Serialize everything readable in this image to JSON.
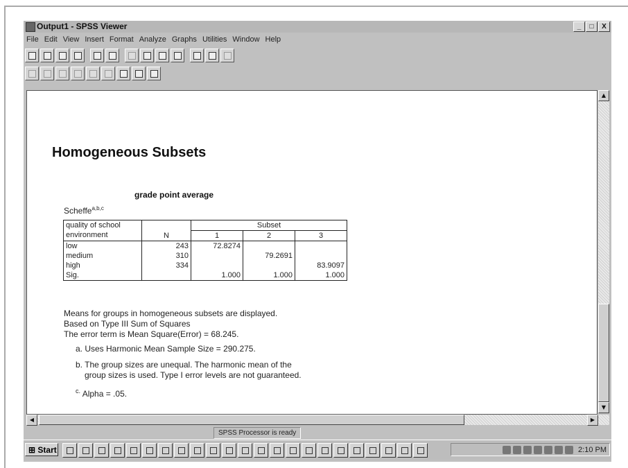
{
  "window": {
    "title": "Output1 - SPSS Viewer",
    "controls": [
      "_",
      "□",
      "X"
    ]
  },
  "menubar": {
    "items": [
      {
        "label": "File"
      },
      {
        "label": "Edit"
      },
      {
        "label": "View"
      },
      {
        "label": "Insert"
      },
      {
        "label": "Format"
      },
      {
        "label": "Analyze"
      },
      {
        "label": "Graphs"
      },
      {
        "label": "Utilities"
      },
      {
        "label": "Window"
      },
      {
        "label": "Help"
      }
    ]
  },
  "document": {
    "heading": "Homogeneous Subsets",
    "table_title": "grade point average",
    "method": "Scheffe",
    "method_superscript": "a,b,c",
    "table": {
      "header_col1_line1": "quality of school",
      "header_col1_line2": "environment",
      "header_n": "N",
      "header_subset": "Subset",
      "subset_labels": [
        "1",
        "2",
        "3"
      ],
      "rows": [
        {
          "label": "low",
          "n": "243",
          "s1": "72.8274",
          "s2": "",
          "s3": ""
        },
        {
          "label": "medium",
          "n": "310",
          "s1": "",
          "s2": "79.2691",
          "s3": ""
        },
        {
          "label": "high",
          "n": "334",
          "s1": "",
          "s2": "",
          "s3": "83.9097"
        },
        {
          "label": "Sig.",
          "n": "",
          "s1": "1.000",
          "s2": "1.000",
          "s3": "1.000"
        }
      ]
    },
    "notes": {
      "line1": "Means for groups in homogeneous subsets are displayed.",
      "line2": "Based on Type III Sum of Squares",
      "line3": "The error term is Mean Square(Error) = 68.245.",
      "fn_a": "a. Uses Harmonic Mean Sample Size = 290.275.",
      "fn_b1": "b. The group sizes are unequal. The harmonic mean of the",
      "fn_b2": "group sizes is used. Type I error levels are not guaranteed.",
      "fn_c_letter": "c.",
      "fn_c_text": "Alpha = .05."
    }
  },
  "statusbar": {
    "text": "SPSS Processor  is ready"
  },
  "taskbar": {
    "start_label": "Start",
    "clock": "2:10 PM"
  }
}
